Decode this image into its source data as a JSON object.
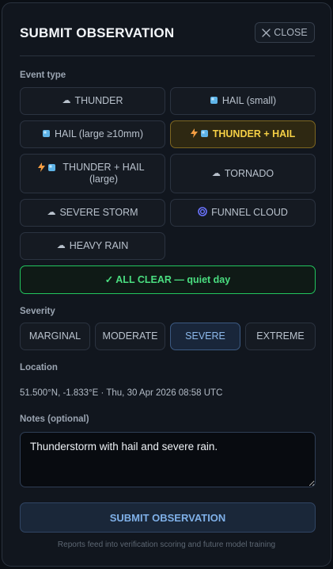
{
  "dialog": {
    "title": "SUBMIT OBSERVATION",
    "close_label": "CLOSE"
  },
  "event_type": {
    "label": "Event type",
    "options": [
      {
        "label": "THUNDER",
        "icons": [
          "cloud-lightning-icon"
        ],
        "selected": false
      },
      {
        "label": "HAIL (small)",
        "icons": [
          "ice-cube-icon"
        ],
        "selected": false
      },
      {
        "label": "HAIL (large ≥10mm)",
        "icons": [
          "ice-cube-icon"
        ],
        "selected": false
      },
      {
        "label": "THUNDER + HAIL",
        "icons": [
          "lightning-bolt-icon",
          "ice-cube-icon"
        ],
        "selected": true
      },
      {
        "label": "THUNDER + HAIL (large)",
        "icons": [
          "lightning-bolt-icon",
          "ice-cube-icon"
        ],
        "selected": false
      },
      {
        "label": "TORNADO",
        "icons": [
          "tornado-icon"
        ],
        "selected": false
      },
      {
        "label": "SEVERE STORM",
        "icons": [
          "storm-cloud-icon"
        ],
        "selected": false
      },
      {
        "label": "FUNNEL CLOUD",
        "icons": [
          "cyclone-icon"
        ],
        "selected": false
      },
      {
        "label": "HEAVY RAIN",
        "icons": [
          "rain-cloud-icon"
        ],
        "selected": false
      }
    ],
    "all_clear_label": "✓ ALL CLEAR — quiet day"
  },
  "severity": {
    "label": "Severity",
    "options": [
      "MARGINAL",
      "MODERATE",
      "SEVERE",
      "EXTREME"
    ],
    "selected": "SEVERE"
  },
  "location": {
    "label": "Location",
    "value": "51.500°N, -1.833°E · Thu, 30 Apr 2026 08:58 UTC"
  },
  "notes": {
    "label": "Notes (optional)",
    "value": "Thunderstorm with hail and severe rain."
  },
  "submit_label": "SUBMIT OBSERVATION",
  "footnote": "Reports feed into verification scoring and future model training",
  "colors": {
    "selected_event": "#f4cf45",
    "all_clear": "#22c55e",
    "selected_severity": "#8cb8ea",
    "submit": "#7fb0e8"
  }
}
